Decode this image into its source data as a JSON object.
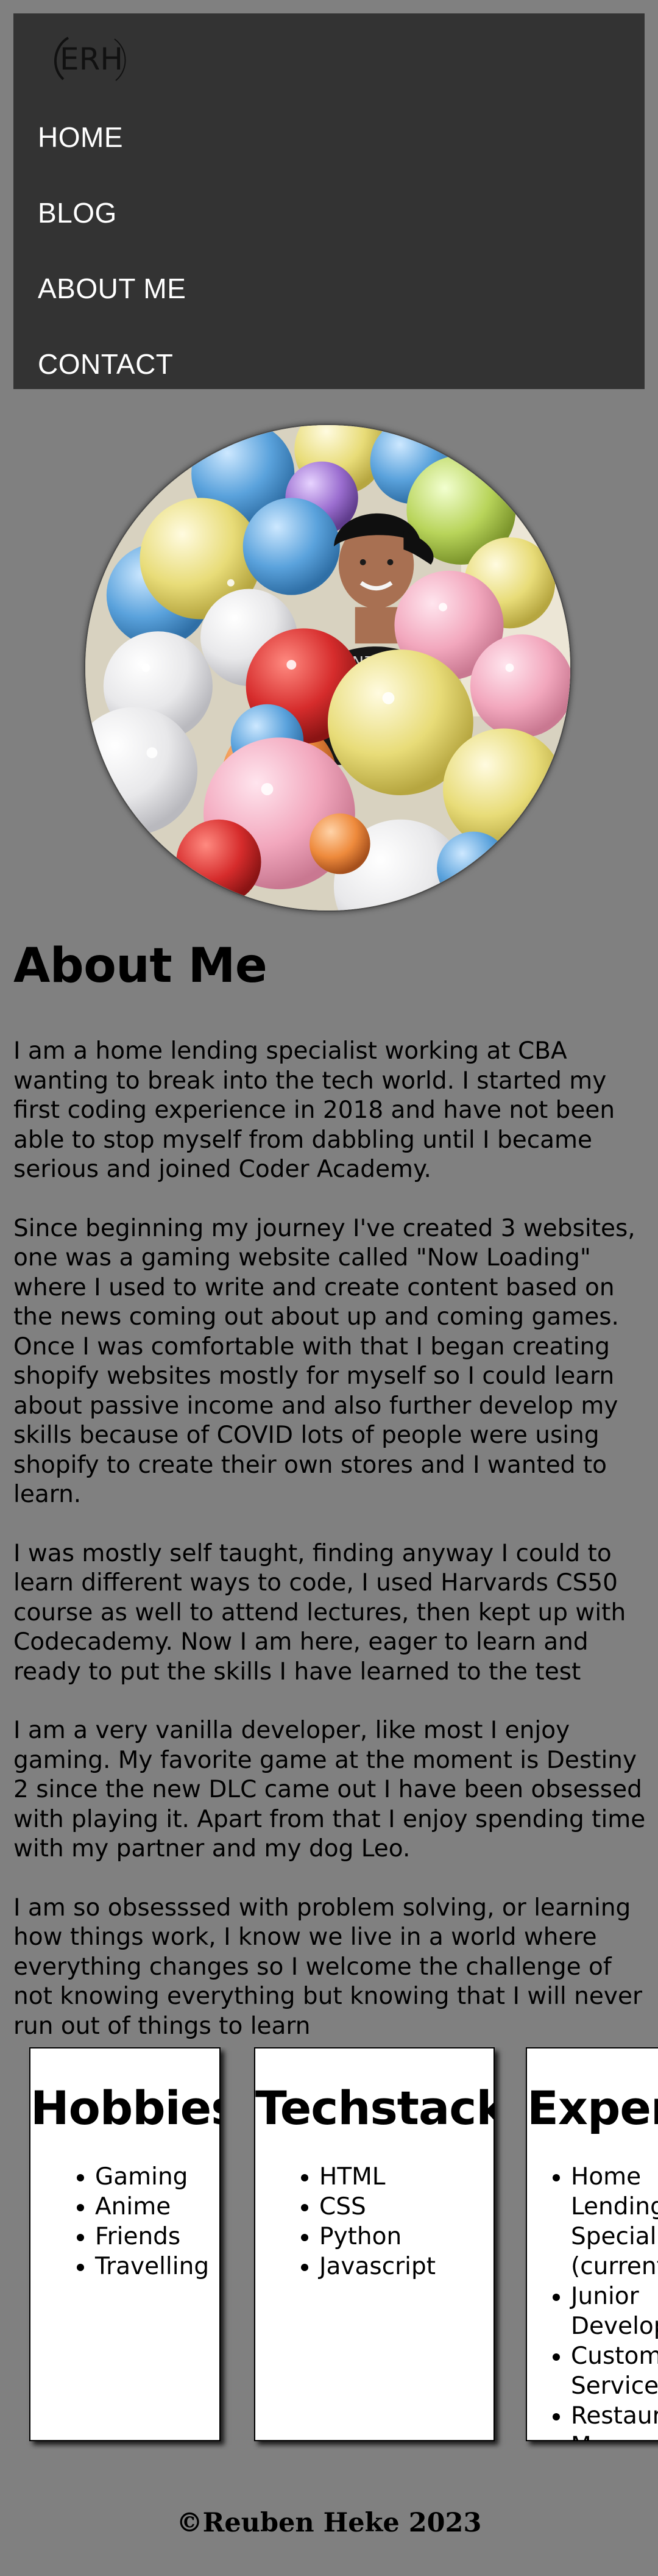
{
  "header": {
    "logo_text": "ERH",
    "logo_icon": "erh-logo",
    "nav": {
      "home": "HOME",
      "blog": "BLOG",
      "about": "ABOUT ME",
      "contact": "CONTACT"
    }
  },
  "profile_image": {
    "alt": "Reuben Heke surrounded by balloons",
    "shape": "circle"
  },
  "about": {
    "title": "About Me",
    "paragraphs": [
      "I am a home lending specialist working at CBA wanting to break into the tech world. I started my first coding experience in 2018 and have not been able to stop myself from dabbling until I became serious and joined Coder Academy.",
      "Since beginning my journey I've created 3 websites, one was a gaming website called \"Now Loading\" where I used to write and create content based on the news coming out about up and coming games. Once I was comfortable with that I began creating shopify websites mostly for myself so I could learn about passive income and also further develop my skills because of COVID lots of people were using shopify to create their own stores and I wanted to learn.",
      "I was mostly self taught, finding anyway I could to learn different ways to code, I used Harvards CS50 course as well to attend lectures, then kept up with Codecademy. Now I am here, eager to learn and ready to put the skills I have learned to the test",
      "I am a very vanilla developer, like most I enjoy gaming. My favorite game at the moment is Destiny 2 since the new DLC came out I have been obsessed with playing it. Apart from that I enjoy spending time with my partner and my dog Leo.",
      "I am so obsesssed with problem solving, or learning how things work, I know we live in a world where everything changes so I welcome the challenge of not knowing everything but knowing that I will never run out of things to learn"
    ]
  },
  "cards": {
    "hobbies": {
      "title": "Hobbies",
      "items": [
        "Gaming",
        "Anime",
        "Friends",
        "Travelling"
      ]
    },
    "techstack": {
      "title": "Techstack",
      "items": [
        "HTML",
        "CSS",
        "Python",
        "Javascript"
      ]
    },
    "experience": {
      "title": "Experience",
      "items": [
        "Home Lending Specialist (current)",
        "Junior Developer",
        "Customer Service",
        "Restaurant Manager"
      ]
    }
  },
  "footer": {
    "copyright": "©Reuben Heke 2023"
  },
  "colors": {
    "page_bg": "#808080",
    "nav_bg": "#333333",
    "nav_text": "#ffffff",
    "card_bg": "#ffffff"
  }
}
